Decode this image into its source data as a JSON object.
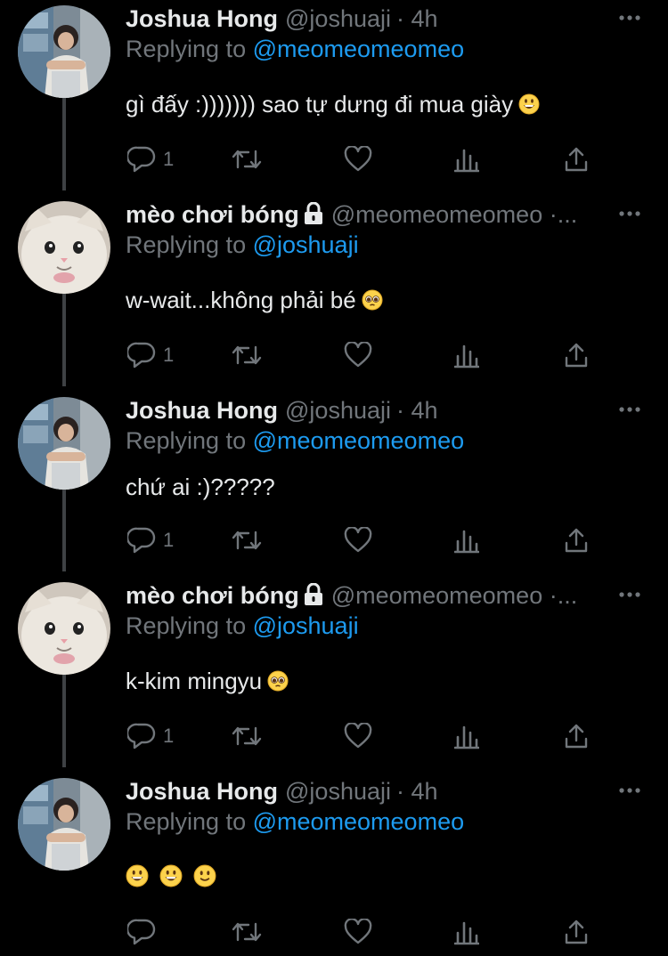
{
  "tweets": [
    {
      "author": "Joshua Hong",
      "handle": "@joshuaji",
      "time": "· 4h",
      "locked": false,
      "avatar": "person-avatar",
      "replying_prefix": "Replying to ",
      "replying_to": "@meomeomeomeo",
      "text": "gì đấy :))))))) sao tự dưng đi mua giày",
      "emojis": [
        "grinning"
      ],
      "reply_count": "1"
    },
    {
      "author": "mèo chơi bóng",
      "handle": "@meomeomeomeo ·...",
      "time": "",
      "locked": true,
      "avatar": "cat-avatar",
      "replying_prefix": "Replying to ",
      "replying_to": "@joshuaji",
      "text": "w-wait...không phải bé",
      "emojis": [
        "pleading"
      ],
      "reply_count": "1"
    },
    {
      "author": "Joshua Hong",
      "handle": "@joshuaji",
      "time": "· 4h",
      "locked": false,
      "avatar": "person-avatar",
      "replying_prefix": "Replying to ",
      "replying_to": "@meomeomeomeo",
      "text": "chứ ai :)?????",
      "emojis": [],
      "reply_count": "1"
    },
    {
      "author": "mèo chơi bóng",
      "handle": "@meomeomeomeo ·...",
      "time": "",
      "locked": true,
      "avatar": "cat-avatar",
      "replying_prefix": "Replying to ",
      "replying_to": "@joshuaji",
      "text": "k-kim mingyu",
      "emojis": [
        "pleading"
      ],
      "reply_count": "1"
    },
    {
      "author": "Joshua Hong",
      "handle": "@joshuaji",
      "time": "· 4h",
      "locked": false,
      "avatar": "person-avatar",
      "replying_prefix": "Replying to ",
      "replying_to": "@meomeomeomeo",
      "text": "",
      "emojis": [
        "grinning",
        "grinning",
        "slight-smile"
      ],
      "reply_count": ""
    }
  ],
  "icons": {
    "reply": "reply-icon",
    "retweet": "retweet-icon",
    "like": "heart-icon",
    "views": "views-icon",
    "share": "share-icon",
    "more": "more-icon",
    "lock": "lock-icon"
  },
  "colors": {
    "background": "#000000",
    "text": "#e7e9ea",
    "muted": "#71767b",
    "link": "#1d9bf0",
    "thread_line": "#3e4144"
  }
}
